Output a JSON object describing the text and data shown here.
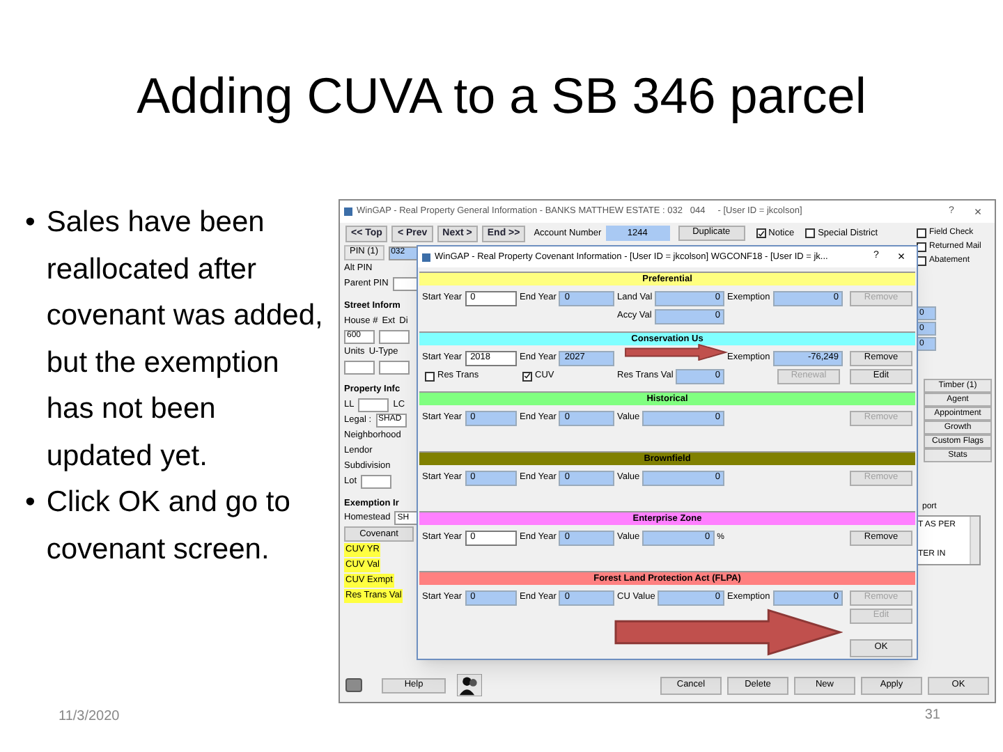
{
  "slide": {
    "title": "Adding CUVA to a SB 346 parcel",
    "bullets": [
      {
        "marker": "•",
        "text": "Sales have been reallocated after covenant was added, but the exemption has not been updated yet."
      },
      {
        "marker": "•",
        "text": "Click OK and go to covenant screen."
      }
    ],
    "date": "11/3/2020",
    "page_number": "31"
  },
  "main_window": {
    "title": "WinGAP - Real Property General Information - BANKS MATTHEW ESTATE : 032   044     - [User ID = jkcolson]",
    "help": "?",
    "close": "×",
    "nav_buttons": [
      "<< Top",
      "< Prev",
      "Next >",
      "End >>"
    ],
    "account_label": "Account Number",
    "account_number": "1244",
    "duplicate": "Duplicate",
    "checkboxes": [
      {
        "label": "Notice",
        "checked": true
      },
      {
        "label": "Special District",
        "checked": false
      }
    ],
    "left_panel": [
      [
        {
          "kind": "tab",
          "text": "PIN (1)"
        },
        {
          "kind": "field",
          "text": "032"
        }
      ],
      [
        {
          "kind": "label",
          "text": "Alt PIN"
        }
      ],
      [
        {
          "kind": "label",
          "text": "Parent PIN"
        },
        {
          "kind": "field"
        }
      ],
      [
        {
          "kind": "heading",
          "text": "Street Inform"
        }
      ],
      [
        {
          "kind": "label",
          "text": "House #"
        },
        {
          "kind": "label",
          "text": "Ext"
        },
        {
          "kind": "label",
          "text": "Di"
        }
      ],
      [
        {
          "kind": "field",
          "text": "600"
        },
        {
          "kind": "field"
        }
      ],
      [
        {
          "kind": "label",
          "text": "Units"
        },
        {
          "kind": "label",
          "text": "U-Type"
        }
      ],
      [
        {
          "kind": "field"
        },
        {
          "kind": "field"
        }
      ],
      [
        {
          "kind": "heading",
          "text": "Property Infc"
        }
      ],
      [
        {
          "kind": "label",
          "text": "LL"
        },
        {
          "kind": "field"
        },
        {
          "kind": "label",
          "text": "LC"
        }
      ],
      [
        {
          "kind": "label",
          "text": "Legal :"
        },
        {
          "kind": "field",
          "text": "SHAD"
        }
      ],
      [
        {
          "kind": "label",
          "text": "Neighborhood"
        }
      ],
      [
        {
          "kind": "label",
          "text": "Lendor"
        }
      ],
      [
        {
          "kind": "label",
          "text": "Subdivision"
        }
      ],
      [
        {
          "kind": "label",
          "text": "Lot"
        },
        {
          "kind": "field"
        }
      ],
      [
        {
          "kind": "heading",
          "text": "Exemption Ir"
        }
      ],
      [
        {
          "kind": "label",
          "text": "Homestead"
        },
        {
          "kind": "field",
          "text": "SH"
        }
      ],
      [
        {
          "kind": "button",
          "text": "Covenant"
        }
      ],
      [
        {
          "kind": "highlight",
          "text": "CUV YR"
        }
      ],
      [
        {
          "kind": "highlight",
          "text": "CUV Val"
        }
      ],
      [
        {
          "kind": "highlight",
          "text": "CUV Exmpt"
        }
      ],
      [
        {
          "kind": "highlight",
          "text": "Res Trans Val"
        }
      ]
    ],
    "right_checkboxes": [
      {
        "label": "Field Check",
        "checked": false
      },
      {
        "label": "Returned Mail",
        "checked": false
      },
      {
        "label": "Abatement",
        "checked": false
      }
    ],
    "right_values": [
      "0",
      "0",
      "0"
    ],
    "side_buttons": [
      "Timber (1)",
      "Agent",
      "Appointment",
      "Growth",
      "Custom Flags",
      "Stats"
    ],
    "report_label": "port",
    "report_lines": [
      "T AS PER",
      "TER IN"
    ],
    "help_button": "Help",
    "bottom_buttons": [
      "Cancel",
      "Delete",
      "New",
      "Apply",
      "OK"
    ]
  },
  "dialog": {
    "title": "WinGAP - Real Property Covenant Information - [User ID = jkcolson] WGCONF18 - [User ID = jk...",
    "help": "?",
    "close": "×",
    "sections": [
      {
        "title": "Preferential",
        "color": "#ffff80",
        "rows": [
          [
            {
              "kind": "field",
              "label": "Start Year",
              "value": "0",
              "editable": true
            },
            {
              "kind": "field",
              "label": "End Year",
              "value": "0",
              "editable": false
            },
            {
              "kind": "field",
              "label": "Land Val",
              "value": "0",
              "editable": false
            },
            {
              "kind": "field",
              "label": "Exemption",
              "value": "0",
              "editable": false
            },
            {
              "kind": "button",
              "label": "Remove",
              "disabled": true
            }
          ],
          [
            "",
            "",
            {
              "kind": "field",
              "label": "Accy Val",
              "value": "0",
              "editable": false
            }
          ]
        ]
      },
      {
        "title": "Conservation Us",
        "color": "#80ffff",
        "rows": [
          [
            {
              "kind": "field",
              "label": "Start Year",
              "value": "2018",
              "editable": true
            },
            {
              "kind": "field",
              "label": "End Year",
              "value": "2027",
              "editable": false
            },
            "",
            {
              "kind": "field",
              "label": "Exemption",
              "value": "-76,249",
              "editable": false
            },
            {
              "kind": "button",
              "label": "Remove",
              "disabled": false
            }
          ],
          [
            {
              "kind": "checkbox",
              "label": "Res Trans",
              "checked": false
            },
            {
              "kind": "checkbox",
              "label": "CUV",
              "checked": true
            },
            {
              "kind": "field",
              "label": "Res Trans Val",
              "value": "0",
              "editable": false
            },
            {
              "kind": "button",
              "label": "Renewal",
              "disabled": true
            },
            {
              "kind": "button",
              "label": "Edit",
              "disabled": false
            }
          ]
        ]
      },
      {
        "title": "Historical",
        "color": "#80ff80",
        "rows": [
          [
            {
              "kind": "field",
              "label": "Start Year",
              "value": "0",
              "editable": false
            },
            {
              "kind": "field",
              "label": "End Year",
              "value": "0",
              "editable": false
            },
            {
              "kind": "field",
              "label": "Value",
              "value": "0",
              "editable": false
            },
            "",
            {
              "kind": "button",
              "label": "Remove",
              "disabled": true
            }
          ]
        ]
      },
      {
        "title": "Brownfield",
        "color": "#808000",
        "rows": [
          [
            {
              "kind": "field",
              "label": "Start Year",
              "value": "0",
              "editable": false
            },
            {
              "kind": "field",
              "label": "End Year",
              "value": "0",
              "editable": false
            },
            {
              "kind": "field",
              "label": "Value",
              "value": "0",
              "editable": false
            },
            "",
            {
              "kind": "button",
              "label": "Remove",
              "disabled": true
            }
          ]
        ]
      },
      {
        "title": "Enterprise Zone",
        "color": "#ff80ff",
        "rows": [
          [
            {
              "kind": "field",
              "label": "Start Year",
              "value": "0",
              "editable": true
            },
            {
              "kind": "field",
              "label": "End Year",
              "value": "0",
              "editable": false
            },
            {
              "kind": "field",
              "label": "Value",
              "value": "0",
              "unit": "%",
              "editable": false
            },
            "",
            {
              "kind": "button",
              "label": "Remove",
              "disabled": false
            }
          ]
        ]
      },
      {
        "title": "Forest Land Protection Act (FLPA)",
        "color": "#ff8080",
        "rows": [
          [
            {
              "kind": "field",
              "label": "Start Year",
              "value": "0",
              "editable": false
            },
            {
              "kind": "field",
              "label": "End Year",
              "value": "0",
              "editable": false
            },
            {
              "kind": "field",
              "label": "CU Value",
              "value": "0",
              "editable": false
            },
            {
              "kind": "field",
              "label": "Exemption",
              "value": "0",
              "editable": false
            },
            {
              "kind": "button",
              "label": "Remove",
              "disabled": true
            }
          ],
          [
            "",
            "",
            "",
            "",
            {
              "kind": "button",
              "label": "Edit",
              "disabled": true
            }
          ]
        ]
      }
    ],
    "ok": "OK"
  }
}
